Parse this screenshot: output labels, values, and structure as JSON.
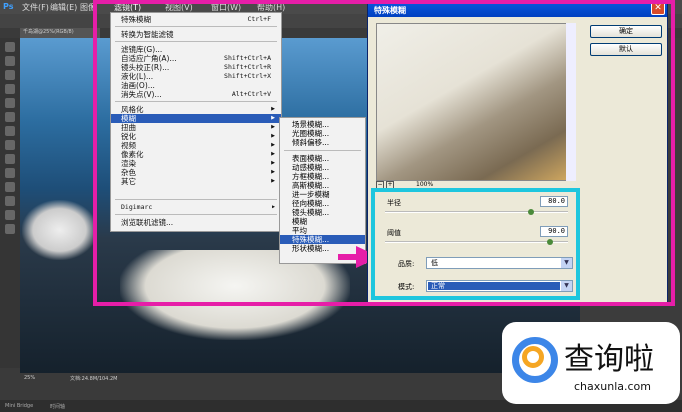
{
  "app": {
    "logo": "Ps",
    "menus": [
      "文件(F)",
      "编辑(E)",
      "图像(I)"
    ],
    "doc_tab": "千岛湖@25%(RGB/8)",
    "status_zoom": "25%",
    "status_doc": "文档:24.8M/104.2M",
    "bottom_tabs": [
      "Mini Bridge",
      "时间轴"
    ]
  },
  "filter_menu": {
    "bar": [
      "滤镜(T)",
      "视图(V)",
      "窗口(W)",
      "帮助(H)"
    ],
    "items": [
      {
        "label": "特殊模糊",
        "shortcut": "Ctrl+F"
      },
      {
        "label": "转换为智能滤镜"
      },
      {
        "label": "滤镜库(G)..."
      },
      {
        "label": "自适应广角(A)...",
        "shortcut": "Shift+Ctrl+A"
      },
      {
        "label": "镜头校正(R)...",
        "shortcut": "Shift+Ctrl+R"
      },
      {
        "label": "液化(L)...",
        "shortcut": "Shift+Ctrl+X"
      },
      {
        "label": "油画(O)..."
      },
      {
        "label": "消失点(V)...",
        "shortcut": "Alt+Ctrl+V"
      },
      {
        "label": "风格化"
      },
      {
        "label": "模糊"
      },
      {
        "label": "扭曲"
      },
      {
        "label": "锐化"
      },
      {
        "label": "视频"
      },
      {
        "label": "像素化"
      },
      {
        "label": "渲染"
      },
      {
        "label": "杂色"
      },
      {
        "label": "其它"
      },
      {
        "label": "Digimarc"
      },
      {
        "label": "浏览联机滤镜..."
      }
    ]
  },
  "blur_submenu": [
    "场景模糊...",
    "光圈模糊...",
    "倾斜偏移...",
    "表面模糊...",
    "动感模糊...",
    "方框模糊...",
    "高斯模糊...",
    "进一步模糊",
    "径向模糊...",
    "镜头模糊...",
    "模糊",
    "平均",
    "特殊模糊...",
    "形状模糊..."
  ],
  "dialog": {
    "title": "特殊模糊",
    "ok": "确定",
    "default": "默认",
    "zoom": "100%",
    "radius_label": "半径",
    "radius": "80.0",
    "radius_fraction": 0.8,
    "threshold_label": "阈值",
    "threshold": "90.0",
    "threshold_fraction": 0.9,
    "quality_label": "品质:",
    "quality": "低",
    "mode_label": "模式:",
    "mode": "正常"
  },
  "watermark": {
    "text": "查询啦",
    "url": "chaxunla.com"
  },
  "colors": {
    "highlight": "#e61ea8",
    "cyan": "#1ec6de",
    "selection": "#2a5cb8"
  }
}
